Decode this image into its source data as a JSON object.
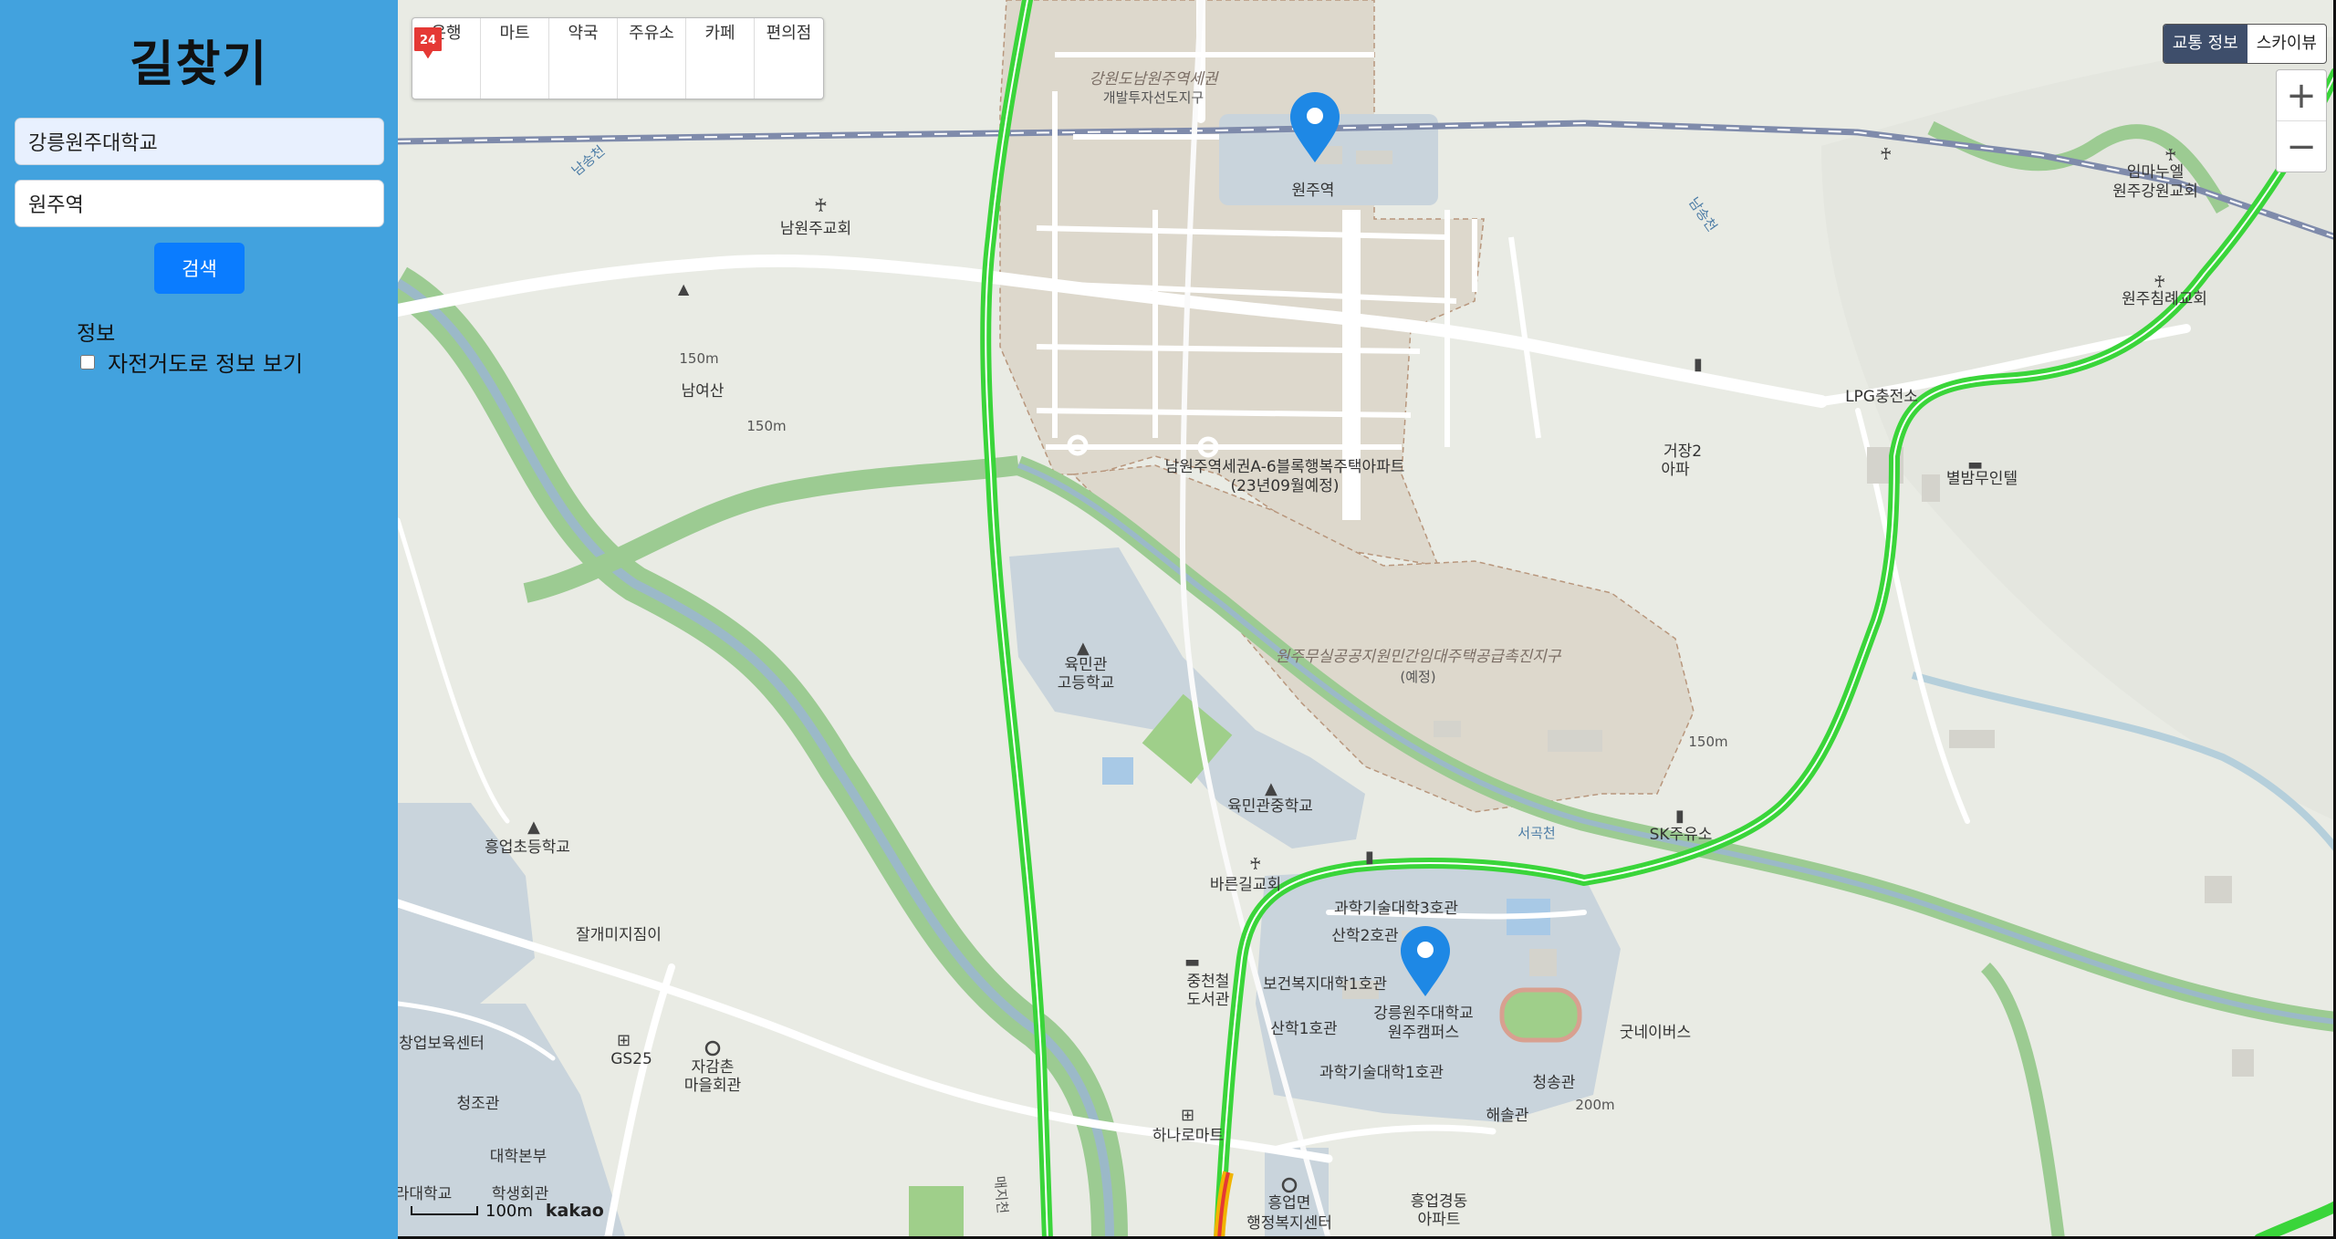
{
  "sidebar": {
    "title": "길찾기",
    "origin_value": "강릉원주대학교",
    "destination_value": "원주역",
    "search_label": "검색",
    "info_title": "정보",
    "bike_label": "자전거도로 정보 보기",
    "bike_checked": false
  },
  "map": {
    "categories": [
      {
        "label": "은행",
        "icon": "bank-icon"
      },
      {
        "label": "마트",
        "icon": "cart-icon"
      },
      {
        "label": "약국",
        "icon": "pharmacy-icon"
      },
      {
        "label": "주유소",
        "icon": "gas-station-icon"
      },
      {
        "label": "카페",
        "icon": "cafe-icon"
      },
      {
        "label": "편의점",
        "icon": "convenience-store-icon"
      }
    ],
    "maptype_traffic": "교통 정보",
    "maptype_skyview": "스카이뷰",
    "zoom_in": "+",
    "zoom_out": "−",
    "scale_label": "100m",
    "logo": "kakao",
    "route_color": "#3ad53a",
    "marker_color": "#1e88e5",
    "labels": {
      "district1": "강원도남원주역세권",
      "district1_sub": "개발투자선도지구",
      "station": "원주역",
      "church_south": "남원주교회",
      "mountain": "남여산",
      "elev1": "150m",
      "elev2": "150m",
      "apt_a6": "남원주역세권A-6블록행복주택아파트",
      "apt_a6_sub": "(23년09월예정)",
      "school_yukmin": "육민관",
      "school_yukmin2": "고등학교",
      "wonju_district": "원주무실공공지원민간임대주택공급촉진지구",
      "wonju_district_sub": "(예정)",
      "middle_school": "육민관중학교",
      "church_bareun": "바른길교회",
      "elementary": "흥업초등학교",
      "jalgae": "잘개미지짐이",
      "sk": "SK주유소",
      "lpg": "LPG충전소",
      "geojang": "거장2",
      "apt2": "아파",
      "byeolbam": "별밤무인텔",
      "church_im": "임마누엘",
      "church_im2": "원주강원교회",
      "church_chim": "원주침례교회",
      "sci3": "과학기술대학3호관",
      "san2": "산학2호관",
      "health1": "보건복지대학1호관",
      "univ": "강릉원주대학교",
      "univ2": "원주캠퍼스",
      "san1": "산학1호관",
      "sci1": "과학기술대학1호관",
      "cheongsong": "청송관",
      "haesol": "해솔관",
      "good": "굿네이버스",
      "elev3": "200m",
      "elev4": "150m",
      "library": "중천철",
      "library2": "도서관",
      "hana": "하나로마트",
      "heungup": "흥업면",
      "heungup2": "행정복지센터",
      "apt_hd": "흥업경동",
      "apt_hd2": "아파트",
      "jagam": "자감촌",
      "jagam2": "마을회관",
      "gs25": "GS25",
      "childcare": "창업보육센터",
      "cheongjo": "청조관",
      "hq": "대학본부",
      "student": "학생회관",
      "univ_left": "라대학교",
      "river1": "남송천",
      "river2": "남송천",
      "river3": "서곡천",
      "road": "매지천"
    }
  }
}
